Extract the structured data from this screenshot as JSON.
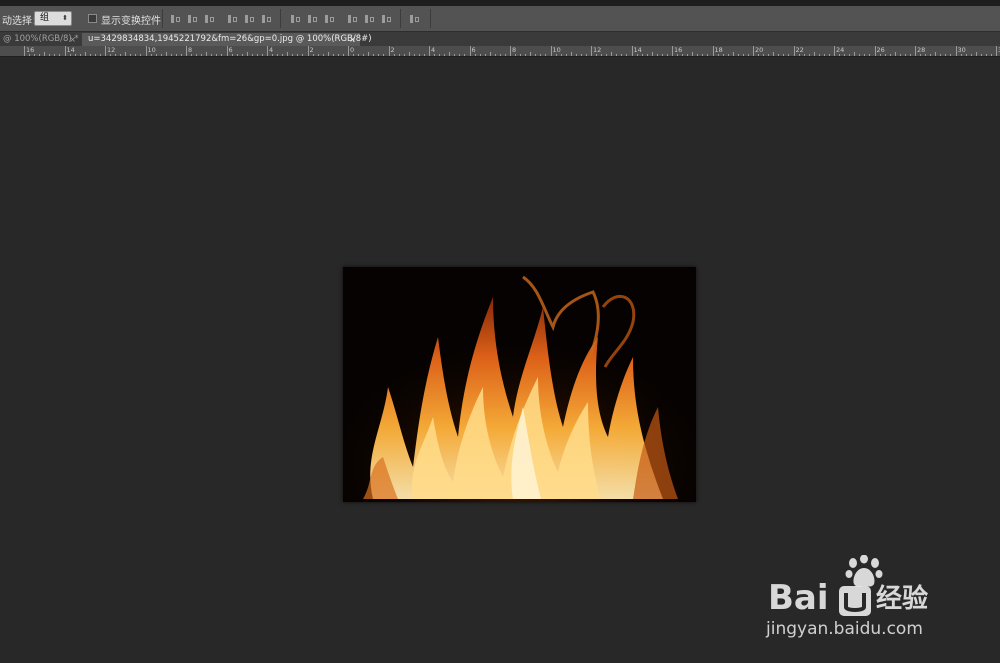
{
  "options_bar": {
    "auto_select_label": "动选择：",
    "auto_select_value": "组",
    "show_transform_label": "显示变换控件"
  },
  "tabs": [
    {
      "label": "@ 100%(RGB/8) *",
      "close": "×"
    },
    {
      "label": "u=3429834834,1945221792&fm=26&gp=0.jpg @ 100%(RGB/8#)",
      "close": "×"
    }
  ],
  "ruler": {
    "labels": [
      "16",
      "14",
      "12",
      "10",
      "8",
      "6",
      "4",
      "2",
      "0",
      "2",
      "4",
      "6",
      "8",
      "10",
      "12",
      "14",
      "16",
      "18",
      "20",
      "22",
      "24",
      "26",
      "28",
      "30",
      "32"
    ]
  },
  "watermark": {
    "brand": "Bai",
    "brand_tail": "经验",
    "url": "jingyan.baidu.com"
  },
  "colors": {
    "canvas": "#282828",
    "options_bar": "#535353",
    "active_tab": "#5a5a5a"
  }
}
